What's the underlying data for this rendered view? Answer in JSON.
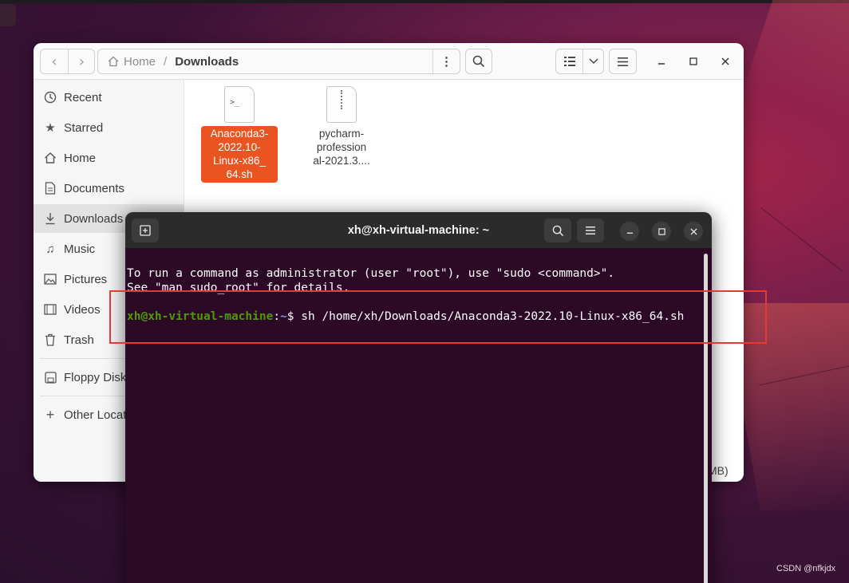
{
  "file_manager": {
    "path": {
      "home": "Home",
      "current": "Downloads"
    },
    "sidebar": [
      {
        "label": "Recent",
        "icon": "clock-icon"
      },
      {
        "label": "Starred",
        "icon": "star-icon"
      },
      {
        "label": "Home",
        "icon": "home-icon"
      },
      {
        "label": "Documents",
        "icon": "document-icon"
      },
      {
        "label": "Downloads",
        "icon": "download-icon",
        "active": true
      },
      {
        "label": "Music",
        "icon": "music-icon"
      },
      {
        "label": "Pictures",
        "icon": "picture-icon"
      },
      {
        "label": "Videos",
        "icon": "video-icon"
      },
      {
        "label": "Trash",
        "icon": "trash-icon"
      },
      {
        "label": "Floppy Disk",
        "icon": "floppy-icon"
      },
      {
        "label": "Other Locat",
        "icon": "plus-icon"
      }
    ],
    "files": [
      {
        "name_lines": [
          "Anaconda3-",
          "2022.10-",
          "Linux-x86_",
          "64.sh"
        ],
        "selected": true,
        "icon": "script-file-icon"
      },
      {
        "name_lines": [
          "pycharm-",
          "profession",
          "al-2021.3...."
        ],
        "selected": false,
        "icon": "archive-file-icon"
      }
    ],
    "status_fragment": "MB)"
  },
  "terminal": {
    "title": "xh@xh-virtual-machine: ~",
    "lines": [
      "To run a command as administrator (user \"root\"), use \"sudo <command>\".",
      "See \"man sudo_root\" for details."
    ],
    "prompt_user": "xh@xh-virtual-machine",
    "prompt_colon": ":",
    "prompt_path": "~",
    "prompt_symbol": "$ ",
    "command": "sh /home/xh/Downloads/Anaconda3-2022.10-Linux-x86_64.sh"
  },
  "watermark": "CSDN @nfkjdx",
  "colors": {
    "selection": "#e95420",
    "terminal_bg": "#2c0a26",
    "highlight_box": "#e53935"
  }
}
